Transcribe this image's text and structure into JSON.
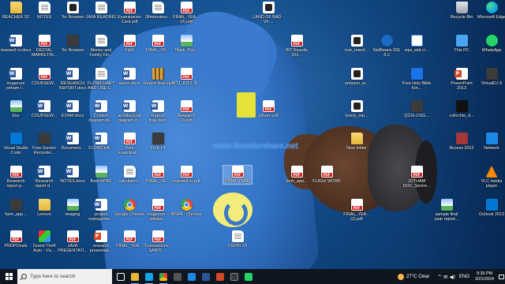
{
  "wallpaper": {
    "watermark": "www.thundershare.net"
  },
  "icons": [
    {
      "label": "REACHER S2",
      "glyph": "folder"
    },
    {
      "label": "NOTES",
      "glyph": "doc"
    },
    {
      "label": "Tor Browser",
      "glyph": "shortcut"
    },
    {
      "label": "JAVA READING ...",
      "glyph": "doc"
    },
    {
      "label": "Examination Card.pdf",
      "glyph": "pdf"
    },
    {
      "label": "28monsters...",
      "glyph": "doc"
    },
    {
      "label": "FINAL_YEA... (9).pdf",
      "glyph": "pdf"
    },
    {
      "label": "LAND OF BAD - VII ...",
      "glyph": "shortcut"
    },
    {
      "label": "Recycle Bin",
      "glyph": "bin"
    },
    {
      "label": "Microsoft Edge",
      "glyph": "edge"
    },
    {
      "label": "maxwell cv.docx",
      "glyph": "word"
    },
    {
      "label": "DIGITAL MARKETIN...",
      "glyph": "pdf"
    },
    {
      "label": "Tor Browser",
      "glyph": "app"
    },
    {
      "label": "Money and Family Fin...",
      "glyph": "doc"
    },
    {
      "label": "F&M",
      "glyph": "pdf"
    },
    {
      "label": "FINAL_YE...",
      "glyph": "pdf"
    },
    {
      "label": "Tiktok_Pict...",
      "glyph": "img"
    },
    {
      "label": "BIT Results 202...",
      "glyph": "pdf"
    },
    {
      "label": "tom_macd...",
      "glyph": "shortcut"
    },
    {
      "label": "NetBeans IDE 8.2",
      "glyph": "netbeans"
    },
    {
      "label": "wps_wid.ci...",
      "glyph": "wps"
    },
    {
      "label": "This PC",
      "glyph": "pc"
    },
    {
      "label": "WhatsApp",
      "glyph": "green"
    },
    {
      "label": "mugerure jotham r...",
      "glyph": "word"
    },
    {
      "label": "COURSEW...",
      "glyph": "pdf"
    },
    {
      "label": "RESEARCH REPORT.docx",
      "glyph": "word"
    },
    {
      "label": "FLOWCHART AND USE C...",
      "glyph": "doc"
    },
    {
      "label": "report.docx",
      "glyph": "word"
    },
    {
      "label": "Report final.zip",
      "glyph": "zip"
    },
    {
      "label": "BIT1_BIT2_B...",
      "glyph": "pdf"
    },
    {
      "label": "eminem_w...",
      "glyph": "shortcut"
    },
    {
      "label": "Free Holy Bible Kin...",
      "glyph": "blue"
    },
    {
      "label": "PowerPoint 2013",
      "glyph": "ppt"
    },
    {
      "label": "VirtualDJ 8",
      "glyph": "app"
    },
    {
      "label": "blur",
      "glyph": "img"
    },
    {
      "label": "COURSEW...",
      "glyph": "word"
    },
    {
      "label": "EXAM.docx",
      "glyph": "word"
    },
    {
      "label": "Context diagram.do...",
      "glyph": "word"
    },
    {
      "label": "architectural diagram.d...",
      "glyph": "word"
    },
    {
      "label": "Report final.docx",
      "glyph": "word"
    },
    {
      "label": "Research (2).pdf",
      "glyph": "pdf"
    },
    {
      "label": "jotham.pdf",
      "glyph": "pdf"
    },
    {
      "label": "lonely_mp...",
      "glyph": "shortcut"
    },
    {
      "label": "QGIS-OSG...",
      "glyph": "app"
    },
    {
      "label": "colicchie_d...",
      "glyph": "black"
    },
    {
      "label": "Visual Studio Code",
      "glyph": "vscode"
    },
    {
      "label": "Free Screen Recorder...",
      "glyph": "app"
    },
    {
      "label": "Document...",
      "glyph": "word"
    },
    {
      "label": "FLOWCHA...",
      "glyph": "word"
    },
    {
      "label": "Print Examinati...",
      "glyph": "pdf"
    },
    {
      "label": "FIFA 14",
      "glyph": "app"
    },
    {
      "label": "New folder",
      "glyph": "folder"
    },
    {
      "label": "Access 2013",
      "glyph": "access"
    },
    {
      "label": "Network",
      "glyph": "net"
    },
    {
      "label": "Research report.p...",
      "glyph": "pdf"
    },
    {
      "label": "Research report.d...",
      "glyph": "word"
    },
    {
      "label": "NOTES.docx",
      "glyph": "word"
    },
    {
      "label": "flowchPNG",
      "glyph": "img"
    },
    {
      "label": "calculator...",
      "glyph": "doc"
    },
    {
      "label": "FINAL_YE...",
      "glyph": "pdf"
    },
    {
      "label": "maxwell cv.pdf",
      "glyph": "pdf"
    },
    {
      "label": "FINAL YEAR",
      "glyph": "pdf"
    },
    {
      "label": "farm_app...",
      "glyph": "pdf"
    },
    {
      "label": "FLASH WORK",
      "glyph": "pdf"
    },
    {
      "label": "JOTHAM DOC_Senior...",
      "glyph": "pdf"
    },
    {
      "label": "VLC media player",
      "glyph": "vlc"
    },
    {
      "label": "farm_app...",
      "glyph": "app"
    },
    {
      "label": "Lenovo",
      "glyph": "folder"
    },
    {
      "label": "imaging",
      "glyph": "img"
    },
    {
      "label": "project manageme...",
      "glyph": "word"
    },
    {
      "label": "Google Chrome",
      "glyph": "chrome"
    },
    {
      "label": "mugerure... jotham...",
      "glyph": "pdf"
    },
    {
      "label": "MSPA - Chrome",
      "glyph": "chrome"
    },
    {
      "label": "FINAL_YEA... (2).pdf",
      "glyph": "pdf"
    },
    {
      "label": "sample final year report...",
      "glyph": "img"
    },
    {
      "label": "Outlook 2013",
      "glyph": "outlook"
    },
    {
      "label": "PROPOsalz",
      "glyph": "pdf"
    },
    {
      "label": "Grand Theft Auto - Vic...",
      "glyph": "paint"
    },
    {
      "label": "JAVA PRESENTATI...",
      "glyph": "pdf"
    },
    {
      "label": "research presentati...",
      "glyph": "ppt"
    },
    {
      "label": "FINAL_YEA...",
      "glyph": "pdf"
    },
    {
      "label": "Transactions - SABITI ...",
      "glyph": "pdf"
    },
    {
      "label": "USPIN S3",
      "glyph": "doc"
    }
  ],
  "taskbar": {
    "search_placeholder": "Type here to search",
    "apps": [
      "task-view",
      "file-explorer",
      "edge",
      "chrome",
      "settings",
      "store",
      "word",
      "powerpoint",
      "camera",
      "whatsapp"
    ],
    "weather": "27°C  Clear",
    "tray_glyphs": "^  ✉  ◀)",
    "language": "ENG",
    "time": "9:35 PM",
    "date": "3/21/2024"
  }
}
